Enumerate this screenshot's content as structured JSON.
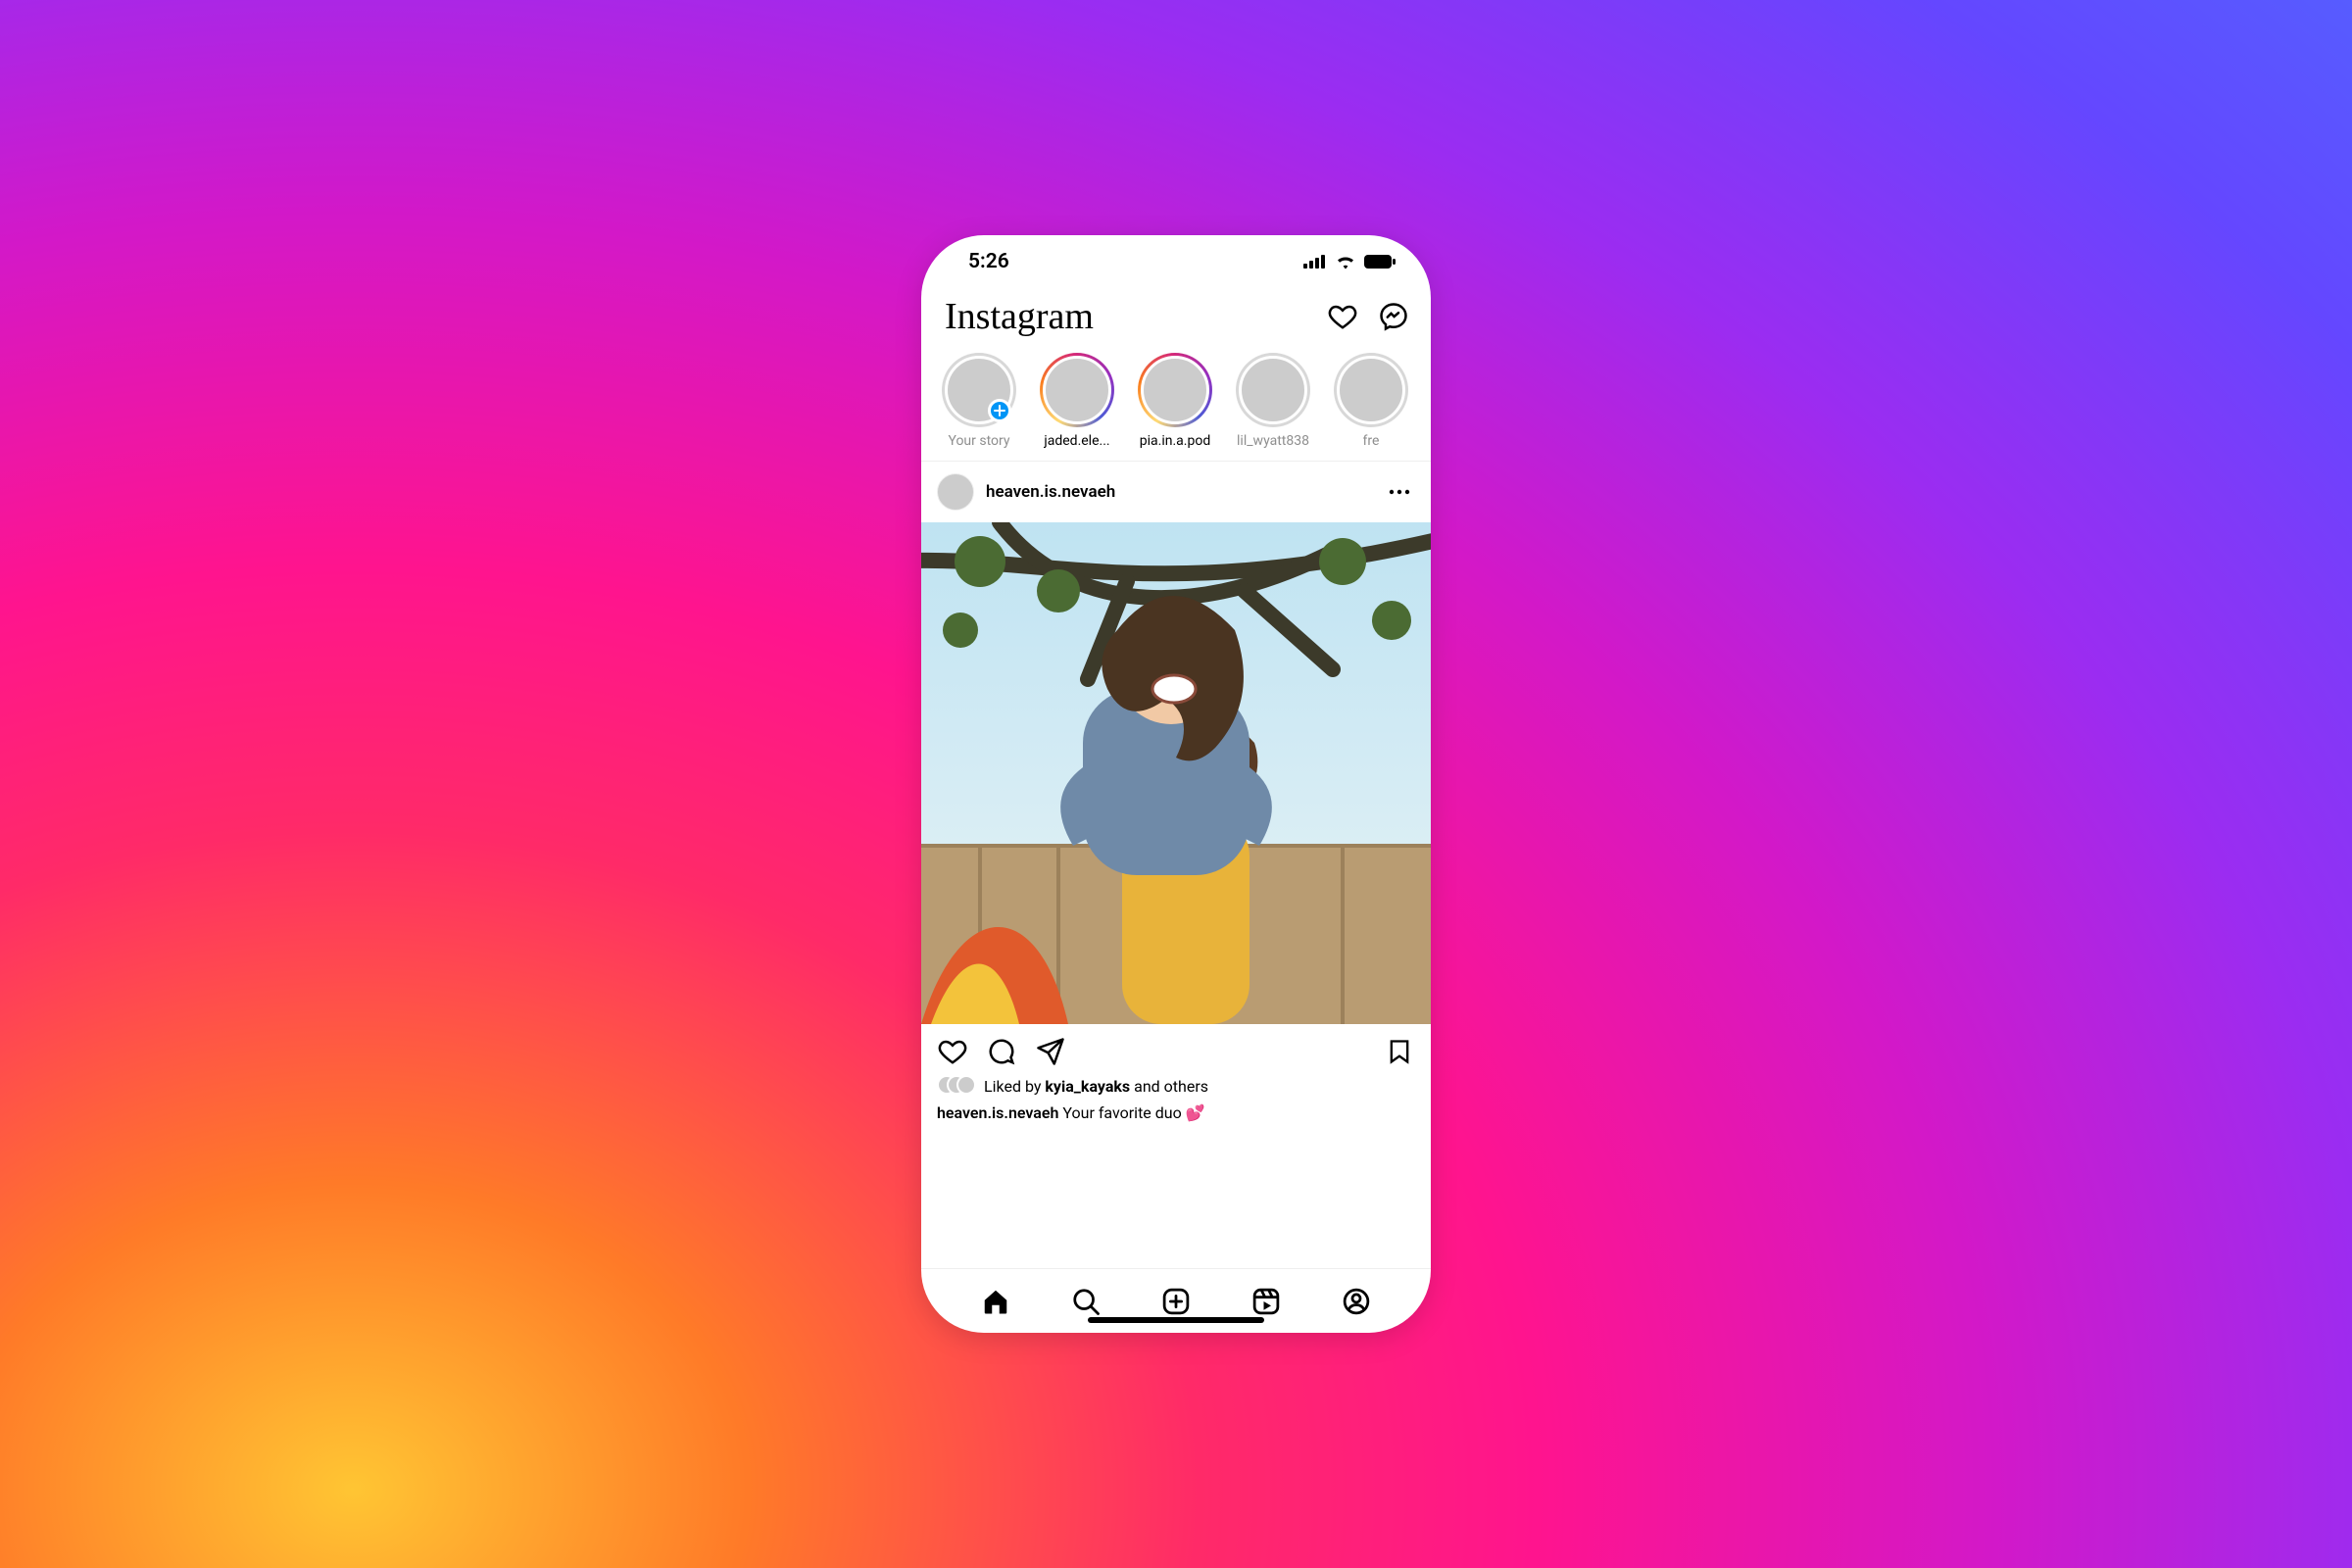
{
  "status": {
    "time": "5:26"
  },
  "header": {
    "logo": "Instagram"
  },
  "stories": [
    {
      "label": "Your story",
      "state": "self"
    },
    {
      "label": "jaded.ele...",
      "state": "unseen"
    },
    {
      "label": "pia.in.a.pod",
      "state": "unseen"
    },
    {
      "label": "lil_wyatt838",
      "state": "seen"
    },
    {
      "label": "fre",
      "state": "seen"
    }
  ],
  "post": {
    "username": "heaven.is.nevaeh",
    "likes": {
      "prefix": "Liked by ",
      "user": "kyia_kayaks",
      "suffix": " and others"
    },
    "caption": {
      "user": "heaven.is.nevaeh",
      "text": " Your favorite duo 💕"
    }
  },
  "tabs": [
    "home",
    "search",
    "create",
    "reels",
    "profile"
  ]
}
